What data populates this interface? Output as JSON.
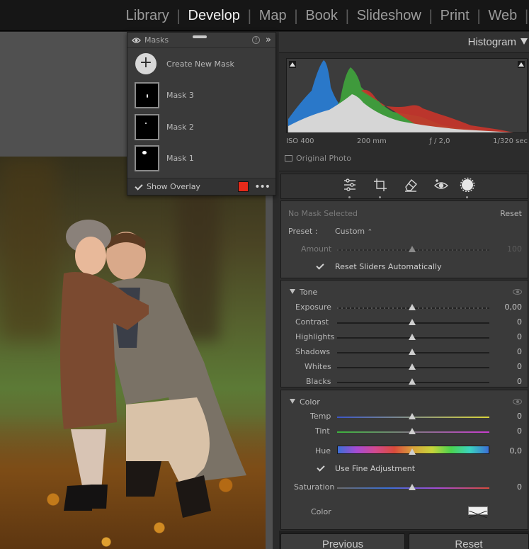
{
  "modules": [
    "Library",
    "Develop",
    "Map",
    "Book",
    "Slideshow",
    "Print",
    "Web"
  ],
  "active_module": "Develop",
  "masks_panel": {
    "title": "Masks",
    "help_glyph": "?",
    "collapse_glyph": "»",
    "create_label": "Create New Mask",
    "create_glyph": "+",
    "masks": [
      "Mask 3",
      "Mask 2",
      "Mask 1"
    ],
    "show_overlay_label": "Show Overlay",
    "overlay_color": "#e52a1a",
    "more_glyph": "•••"
  },
  "histogram": {
    "title": "Histogram",
    "iso": "ISO 400",
    "focal": "200 mm",
    "aperture": "ƒ / 2,0",
    "shutter": "1/320 sec",
    "original_photo_label": "Original Photo"
  },
  "mask_settings": {
    "no_mask": "No Mask Selected",
    "reset": "Reset",
    "preset_label": "Preset :",
    "preset_value": "Custom",
    "preset_arrows": "⌃",
    "amount_label": "Amount",
    "amount_value": "100",
    "reset_sliders_label": "Reset Sliders Automatically"
  },
  "tone": {
    "title": "Tone",
    "sliders": [
      {
        "label": "Exposure",
        "value": "0,00"
      },
      {
        "label": "Contrast",
        "value": "0"
      },
      {
        "label": "Highlights",
        "value": "0"
      },
      {
        "label": "Shadows",
        "value": "0"
      },
      {
        "label": "Whites",
        "value": "0"
      },
      {
        "label": "Blacks",
        "value": "0"
      }
    ]
  },
  "color": {
    "title": "Color",
    "temp_label": "Temp",
    "temp_value": "0",
    "tint_label": "Tint",
    "tint_value": "0",
    "hue_label": "Hue",
    "hue_value": "0,0",
    "fine_label": "Use Fine Adjustment",
    "saturation_label": "Saturation",
    "saturation_value": "0",
    "color_label": "Color"
  },
  "buttons": {
    "previous": "Previous",
    "reset": "Reset"
  }
}
